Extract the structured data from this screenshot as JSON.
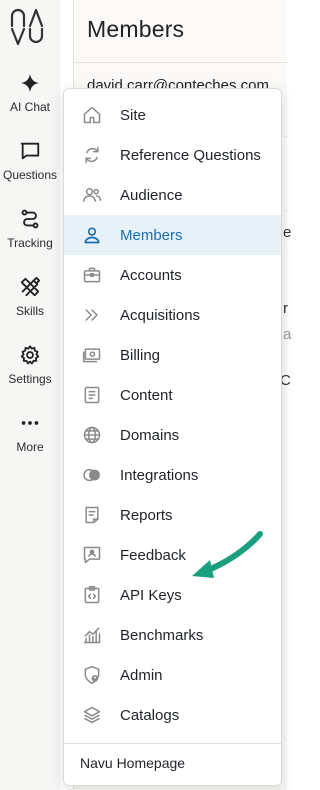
{
  "colors": {
    "accent": "#1f6fae",
    "active_bg": "#e7f1f8",
    "arrow": "#1aa07e",
    "icon": "#8a8a8a"
  },
  "logo": {
    "icon": "navu-logo"
  },
  "rail": {
    "items": [
      {
        "label": "AI Chat",
        "icon": "sparkle-icon"
      },
      {
        "label": "Questions",
        "icon": "chat-bubble-icon"
      },
      {
        "label": "Tracking",
        "icon": "route-icon"
      },
      {
        "label": "Skills",
        "icon": "pencil-ruler-icon"
      },
      {
        "label": "Settings",
        "icon": "gear-icon"
      },
      {
        "label": "More",
        "icon": "more-dots-icon"
      }
    ]
  },
  "page": {
    "title": "Members",
    "email": "david.carr@conteches.com",
    "peek_1": "e",
    "peek_2": "r",
    "peek_3": "a",
    "peek_4": "C"
  },
  "menu": {
    "items": [
      {
        "label": "Site",
        "icon": "home-icon",
        "active": false
      },
      {
        "label": "Reference Questions",
        "icon": "refresh-icon",
        "active": false
      },
      {
        "label": "Audience",
        "icon": "users-icon",
        "active": false
      },
      {
        "label": "Members",
        "icon": "person-icon",
        "active": true
      },
      {
        "label": "Accounts",
        "icon": "briefcase-icon",
        "active": false
      },
      {
        "label": "Acquisitions",
        "icon": "double-chevron-icon",
        "active": false
      },
      {
        "label": "Billing",
        "icon": "money-icon",
        "active": false
      },
      {
        "label": "Content",
        "icon": "document-icon",
        "active": false
      },
      {
        "label": "Domains",
        "icon": "globe-icon",
        "active": false
      },
      {
        "label": "Integrations",
        "icon": "toggle-circles-icon",
        "active": false
      },
      {
        "label": "Reports",
        "icon": "report-icon",
        "active": false
      },
      {
        "label": "Feedback",
        "icon": "feedback-icon",
        "active": false
      },
      {
        "label": "API Keys",
        "icon": "code-clipboard-icon",
        "active": false
      },
      {
        "label": "Benchmarks",
        "icon": "bar-chart-icon",
        "active": false
      },
      {
        "label": "Admin",
        "icon": "shield-user-icon",
        "active": false
      },
      {
        "label": "Catalogs",
        "icon": "layers-icon",
        "active": false
      }
    ],
    "footer": "Navu Homepage"
  }
}
